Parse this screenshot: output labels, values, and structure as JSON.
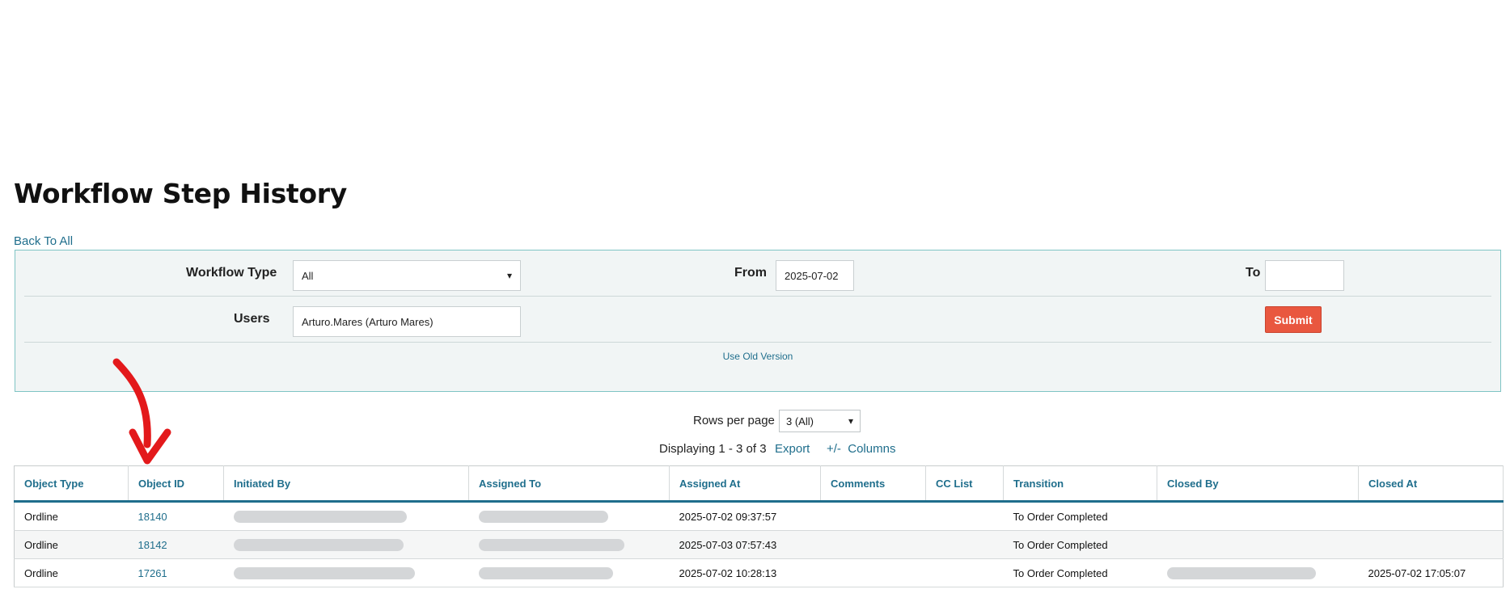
{
  "page": {
    "title": "Workflow Step History",
    "back_link": "Back To All"
  },
  "filters": {
    "workflow_type_label": "Workflow Type",
    "workflow_type_value": "All",
    "from_label": "From",
    "from_value": "2025-07-02",
    "to_label": "To",
    "to_value": "",
    "users_label": "Users",
    "users_value": "Arturo.Mares (Arturo Mares)",
    "submit_label": "Submit",
    "old_version_link": "Use Old Version"
  },
  "pagination": {
    "rows_per_page_label": "Rows per page",
    "rows_per_page_value": "3 (All)",
    "displaying": "Displaying 1 - 3 of 3",
    "export_link": "Export",
    "columns_link": "+/-  Columns"
  },
  "table": {
    "headers": [
      "Object Type",
      "Object ID",
      "Initiated By",
      "Assigned To",
      "Assigned At",
      "Comments",
      "CC List",
      "Transition",
      "Closed By",
      "Closed At"
    ],
    "rows": [
      {
        "object_type": "Ordline",
        "object_id": "18140",
        "assigned_at": "2025-07-02 09:37:57",
        "comments": "",
        "cc_list": "",
        "transition": "To Order Completed",
        "closed_at": ""
      },
      {
        "object_type": "Ordline",
        "object_id": "18142",
        "assigned_at": "2025-07-03 07:57:43",
        "comments": "",
        "cc_list": "",
        "transition": "To Order Completed",
        "closed_at": ""
      },
      {
        "object_type": "Ordline",
        "object_id": "17261",
        "assigned_at": "2025-07-02 10:28:13",
        "comments": "",
        "cc_list": "",
        "transition": "To Order Completed",
        "closed_at": "2025-07-02 17:05:07"
      }
    ]
  },
  "colors": {
    "link": "#1f6e8c",
    "submit": "#e9573f",
    "annotation": "#e3191b",
    "panel_border": "#7fc4c4"
  },
  "icons": {
    "select_caret": "chevron-down-icon",
    "annotation": "red-arrow-annotation"
  }
}
